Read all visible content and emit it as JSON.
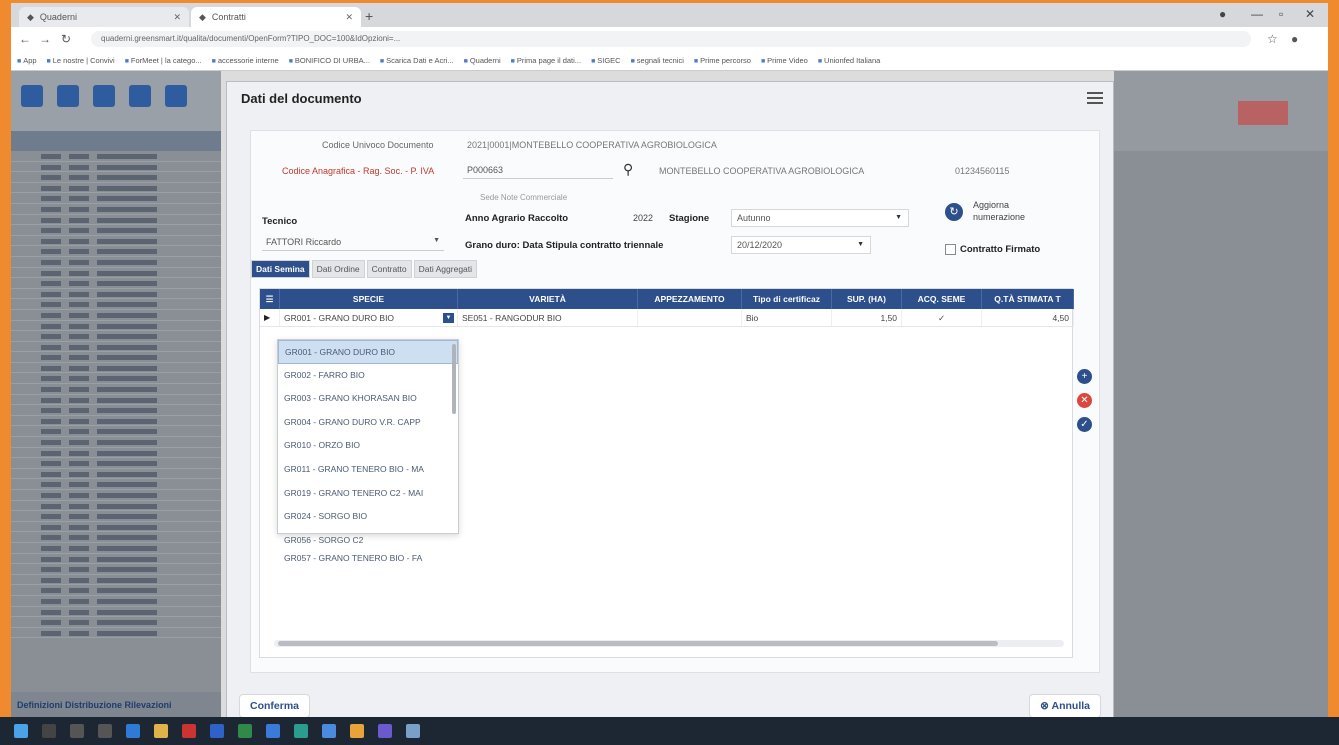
{
  "browser": {
    "tabs": [
      {
        "label": "Quaderni"
      },
      {
        "label": "Contratti"
      }
    ],
    "url": "quaderni.greensmart.it/qualita/documenti/OpenForm?TIPO_DOC=100&IdOpzioni=..."
  },
  "bookmarks": [
    "App",
    "Le nostre | Convivi",
    "ForMeet | la catego...",
    "accessorie interne",
    "BONIFICO DI URBA...",
    "Scarica Dati e Acri...",
    "Quaderni",
    "Prima page il dati...",
    "SIGEC",
    "segnali tecnici",
    "Prime percorso",
    "Prime Video",
    "Unionfed Italiana"
  ],
  "background_app": {
    "left_bottom_tabs": [
      "Definizioni",
      "Distribuzione",
      "Rilevazioni"
    ]
  },
  "modal": {
    "title": "Dati del documento",
    "codice_univoco_label": "Codice Univoco Documento",
    "codice_univoco_value": "2021|0001|MONTEBELLO COOPERATIVA AGROBIOLOGICA",
    "codice_anagrafica_label": "Codice Anagrafica - Rag. Soc. - P. IVA",
    "codice_anagrafica_value": "P000663",
    "ragione_sociale": "MONTEBELLO COOPERATIVA AGROBIOLOGICA",
    "partita_iva": "01234560115",
    "sede_note": "Sede Note Commerciale",
    "tecnico_label": "Tecnico",
    "tecnico_value": "FATTORI Riccardo",
    "anno_label": "Anno Agrario Raccolto",
    "anno_value": "2022",
    "stagione_label": "Stagione",
    "stagione_value": "Autunno",
    "aggiorna_label_1": "Aggiorna",
    "aggiorna_label_2": "numerazione",
    "grano_label": "Grano duro: Data Stipula contratto triennale",
    "grano_value": "20/12/2020",
    "contratto_firmato_label": "Contratto Firmato",
    "tabs": [
      "Dati Semina",
      "Dati Ordine",
      "Contratto",
      "Dati Aggregati"
    ],
    "table": {
      "headers": [
        "SPECIE",
        "VARIETÀ",
        "APPEZZAMENTO",
        "Tipo di certificaz",
        "SUP. (HA)",
        "ACQ. SEME",
        "Q.TÀ STIMATA T"
      ],
      "row": {
        "specie": "GR001 - GRANO DURO BIO",
        "varieta": "SE051 - RANGODUR BIO",
        "appezzamento": "",
        "tipo_cert": "Bio",
        "sup": "1,50",
        "acq_seme": "✓",
        "qta": "4,50"
      }
    },
    "dropdown_options": [
      "GR001 - GRANO DURO BIO",
      "GR002 - FARRO BIO",
      "GR003 - GRANO KHORASAN BIO",
      "GR004 - GRANO DURO V.R. CAPP",
      "GR010 - ORZO BIO",
      "GR011 - GRANO TENERO BIO - MA",
      "GR019 - GRANO TENERO C2 - MAI",
      "GR024 - SORGO BIO",
      "GR056 - SORGO C2",
      "GR057 - GRANO TENERO BIO - FA"
    ],
    "confirm_label": "Conferma",
    "cancel_label": "Annulla"
  },
  "colors": {
    "accent": "#2d4f8c",
    "frame_border": "#f08a2e",
    "delete": "#d9473f"
  }
}
